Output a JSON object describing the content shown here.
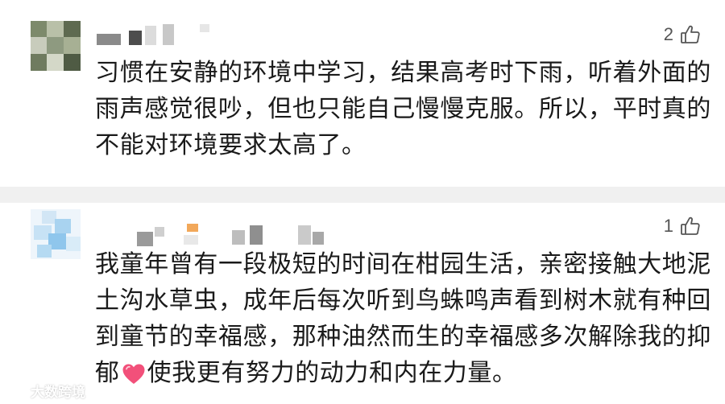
{
  "comments": [
    {
      "likes": "2",
      "text": "习惯在安静的环境中学习，结果高考时下雨，听着外面的雨声感觉很吵，但也只能自己慢慢克服。所以，平时真的不能对环境要求太高了。"
    },
    {
      "likes": "1",
      "text_before_emoji": "我童年曾有一段极短的时间在柑园生活，亲密接触大地泥土沟水草虫，成年后每次听到鸟蛛鸣声看到树木就有种回到童节的幸福感，那种油然而生的幸福感多次解除我的抑郁",
      "emoji": "heart-emoji",
      "text_after_emoji": "使我更有努力的动力和内在力量。"
    }
  ],
  "watermark": {
    "text": "大数跨境",
    "icon": "brand-logo-icon"
  },
  "colors": {
    "heart": "#f2507a",
    "separator": "#f0f0f0",
    "text": "#1a1a1a",
    "meta": "#555555"
  }
}
